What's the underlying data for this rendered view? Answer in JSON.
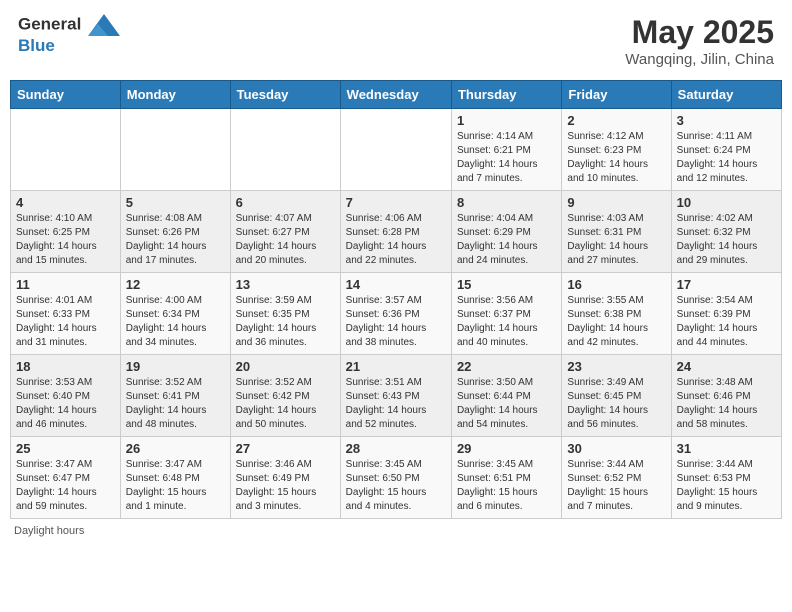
{
  "header": {
    "logo_line1": "General",
    "logo_line2": "Blue",
    "main_title": "May 2025",
    "subtitle": "Wangqing, Jilin, China"
  },
  "days_of_week": [
    "Sunday",
    "Monday",
    "Tuesday",
    "Wednesday",
    "Thursday",
    "Friday",
    "Saturday"
  ],
  "weeks": [
    [
      {
        "day": "",
        "info": ""
      },
      {
        "day": "",
        "info": ""
      },
      {
        "day": "",
        "info": ""
      },
      {
        "day": "",
        "info": ""
      },
      {
        "day": "1",
        "info": "Sunrise: 4:14 AM\nSunset: 6:21 PM\nDaylight: 14 hours\nand 7 minutes."
      },
      {
        "day": "2",
        "info": "Sunrise: 4:12 AM\nSunset: 6:23 PM\nDaylight: 14 hours\nand 10 minutes."
      },
      {
        "day": "3",
        "info": "Sunrise: 4:11 AM\nSunset: 6:24 PM\nDaylight: 14 hours\nand 12 minutes."
      }
    ],
    [
      {
        "day": "4",
        "info": "Sunrise: 4:10 AM\nSunset: 6:25 PM\nDaylight: 14 hours\nand 15 minutes."
      },
      {
        "day": "5",
        "info": "Sunrise: 4:08 AM\nSunset: 6:26 PM\nDaylight: 14 hours\nand 17 minutes."
      },
      {
        "day": "6",
        "info": "Sunrise: 4:07 AM\nSunset: 6:27 PM\nDaylight: 14 hours\nand 20 minutes."
      },
      {
        "day": "7",
        "info": "Sunrise: 4:06 AM\nSunset: 6:28 PM\nDaylight: 14 hours\nand 22 minutes."
      },
      {
        "day": "8",
        "info": "Sunrise: 4:04 AM\nSunset: 6:29 PM\nDaylight: 14 hours\nand 24 minutes."
      },
      {
        "day": "9",
        "info": "Sunrise: 4:03 AM\nSunset: 6:31 PM\nDaylight: 14 hours\nand 27 minutes."
      },
      {
        "day": "10",
        "info": "Sunrise: 4:02 AM\nSunset: 6:32 PM\nDaylight: 14 hours\nand 29 minutes."
      }
    ],
    [
      {
        "day": "11",
        "info": "Sunrise: 4:01 AM\nSunset: 6:33 PM\nDaylight: 14 hours\nand 31 minutes."
      },
      {
        "day": "12",
        "info": "Sunrise: 4:00 AM\nSunset: 6:34 PM\nDaylight: 14 hours\nand 34 minutes."
      },
      {
        "day": "13",
        "info": "Sunrise: 3:59 AM\nSunset: 6:35 PM\nDaylight: 14 hours\nand 36 minutes."
      },
      {
        "day": "14",
        "info": "Sunrise: 3:57 AM\nSunset: 6:36 PM\nDaylight: 14 hours\nand 38 minutes."
      },
      {
        "day": "15",
        "info": "Sunrise: 3:56 AM\nSunset: 6:37 PM\nDaylight: 14 hours\nand 40 minutes."
      },
      {
        "day": "16",
        "info": "Sunrise: 3:55 AM\nSunset: 6:38 PM\nDaylight: 14 hours\nand 42 minutes."
      },
      {
        "day": "17",
        "info": "Sunrise: 3:54 AM\nSunset: 6:39 PM\nDaylight: 14 hours\nand 44 minutes."
      }
    ],
    [
      {
        "day": "18",
        "info": "Sunrise: 3:53 AM\nSunset: 6:40 PM\nDaylight: 14 hours\nand 46 minutes."
      },
      {
        "day": "19",
        "info": "Sunrise: 3:52 AM\nSunset: 6:41 PM\nDaylight: 14 hours\nand 48 minutes."
      },
      {
        "day": "20",
        "info": "Sunrise: 3:52 AM\nSunset: 6:42 PM\nDaylight: 14 hours\nand 50 minutes."
      },
      {
        "day": "21",
        "info": "Sunrise: 3:51 AM\nSunset: 6:43 PM\nDaylight: 14 hours\nand 52 minutes."
      },
      {
        "day": "22",
        "info": "Sunrise: 3:50 AM\nSunset: 6:44 PM\nDaylight: 14 hours\nand 54 minutes."
      },
      {
        "day": "23",
        "info": "Sunrise: 3:49 AM\nSunset: 6:45 PM\nDaylight: 14 hours\nand 56 minutes."
      },
      {
        "day": "24",
        "info": "Sunrise: 3:48 AM\nSunset: 6:46 PM\nDaylight: 14 hours\nand 58 minutes."
      }
    ],
    [
      {
        "day": "25",
        "info": "Sunrise: 3:47 AM\nSunset: 6:47 PM\nDaylight: 14 hours\nand 59 minutes."
      },
      {
        "day": "26",
        "info": "Sunrise: 3:47 AM\nSunset: 6:48 PM\nDaylight: 15 hours\nand 1 minute."
      },
      {
        "day": "27",
        "info": "Sunrise: 3:46 AM\nSunset: 6:49 PM\nDaylight: 15 hours\nand 3 minutes."
      },
      {
        "day": "28",
        "info": "Sunrise: 3:45 AM\nSunset: 6:50 PM\nDaylight: 15 hours\nand 4 minutes."
      },
      {
        "day": "29",
        "info": "Sunrise: 3:45 AM\nSunset: 6:51 PM\nDaylight: 15 hours\nand 6 minutes."
      },
      {
        "day": "30",
        "info": "Sunrise: 3:44 AM\nSunset: 6:52 PM\nDaylight: 15 hours\nand 7 minutes."
      },
      {
        "day": "31",
        "info": "Sunrise: 3:44 AM\nSunset: 6:53 PM\nDaylight: 15 hours\nand 9 minutes."
      }
    ]
  ],
  "footer": {
    "daylight_hours_label": "Daylight hours"
  }
}
